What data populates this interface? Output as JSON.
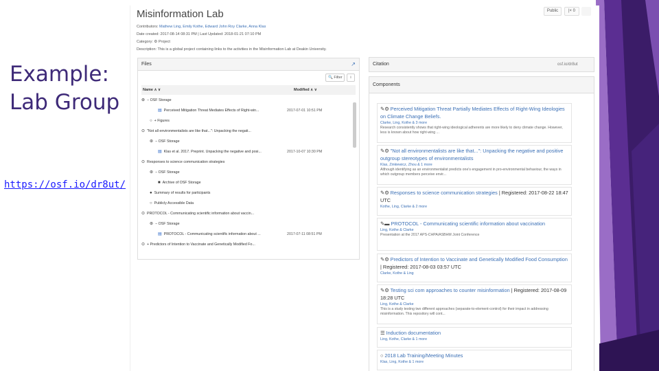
{
  "slide": {
    "title_line1": "Example:",
    "title_line2": "Lab Group",
    "link": "https://osf.io/dr8ut/"
  },
  "project": {
    "title": "Misinformation Lab",
    "public_label": "Public",
    "fork_label": "|× 0",
    "contributors_label": "Contributors:",
    "contributors": "Mathew Ling, Emily Kothe, Edward John Roy Clarke, Anna Klas",
    "date_created": "Date created: 2017-08-14 08:31 PM | Last Updated: 2018-01-21 07:10 PM",
    "category": "Category: ⚙ Project",
    "description": "Description: This is a global project containing links to the activities in the Misinformation Lab at Deakin University."
  },
  "files": {
    "header": "Files",
    "filter_label": "🔍 Filter",
    "col_name": "Name ∧ ∨",
    "col_modified": "Modified ∧ ∨",
    "rows": [
      {
        "name": "− OSF Storage",
        "icon": "⊛",
        "modified": ""
      },
      {
        "name": "Perceived Mitigation Threat Mediates Effects of Right-win...",
        "icon": "▤",
        "modified": "2017-07-01 10:51 PM"
      },
      {
        "name": "+ Figures",
        "icon": "○",
        "modified": ""
      },
      {
        "name": "\"Not all environmentalists are like that...\": Unpacking the negati...",
        "icon": "⊙",
        "modified": ""
      },
      {
        "name": "− OSF Storage",
        "icon": "⊛",
        "modified": ""
      },
      {
        "name": "Klas et al. 2017. Preprint. Unpacking the negative and posi...",
        "icon": "▤",
        "modified": "2017-10-07 10:30 PM"
      },
      {
        "name": "Responses to science communication strategies",
        "icon": "⊙",
        "modified": ""
      },
      {
        "name": "− OSF Storage",
        "icon": "⊛",
        "modified": ""
      },
      {
        "name": "Archive of OSF Storage",
        "icon": "■",
        "modified": ""
      },
      {
        "name": "Summary of results for participants",
        "icon": "●",
        "modified": ""
      },
      {
        "name": "Publicly Accessible Data",
        "icon": "○",
        "modified": ""
      },
      {
        "name": "PROTOCOL - Communicating scientific information about vaccin...",
        "icon": "⊙",
        "modified": ""
      },
      {
        "name": "− OSF Storage",
        "icon": "⊛",
        "modified": ""
      },
      {
        "name": "PROTOCOL - Communicating scientific information about ...",
        "icon": "▤",
        "modified": "2017-07-11 08:51 PM"
      },
      {
        "name": "+ Predictors of Intention to Vaccinate and Genetically Modified Fo...",
        "icon": "⊙",
        "modified": ""
      }
    ]
  },
  "citation": {
    "header": "Citation",
    "value": "osf.io/dr8ut"
  },
  "components": {
    "header": "Components",
    "items": [
      {
        "icon": "✎⚙",
        "title": "Perceived Mitigation Threat Partially Mediates Effects of Right-Wing Ideologies on Climate Change Beliefs.",
        "reg": "",
        "contrib": "Clarke, Ling, Kothe & 3 more",
        "desc": "Research consistently shows that right-wing ideological adherents are more likely to deny climate change. However, less is known about how right-wing ..."
      },
      {
        "icon": "✎⚙",
        "title": "\"Not all environmentalists are like that...\": Unpacking the negative and positive outgroup stereotypes of environmentalists",
        "reg": "",
        "contrib": "Klas, Zinkiewicz, Zhou & 1 more",
        "desc": "Although identifying as an environmentalist predicts one's engagement in pro-environmental behaviour, the ways in which outgroup members perceive envir..."
      },
      {
        "icon": "✎⚙",
        "title": "Responses to science communication strategies",
        "reg": " | Registered: 2017-08-22 18:47 UTC",
        "contrib": "Kothe, Ling, Clarke & 2 more",
        "desc": ""
      },
      {
        "icon": "✎▬",
        "title": "PROTOCOL - Communicating scientific information about vaccination",
        "reg": "",
        "contrib": "Ling, Kothe & Clarke",
        "desc": "Presentation at the 2017 APS-CHPA/ASBHM Joint Conference"
      },
      {
        "icon": "✎⚙",
        "title": "Predictors of Intention to Vaccinate and Genetically Modified Food Consumption",
        "reg": " | Registered: 2017-08-03 03:57 UTC",
        "contrib": "Clarke, Kothe & Ling",
        "desc": ""
      },
      {
        "icon": "✎⚙",
        "title": "Testing sci com approaches to counter misinformation",
        "reg": " | Registered: 2017-08-09 18:28 UTC",
        "contrib": "Ling, Kothe & Clarke",
        "desc": "This is a study testing two different approaches (separate-to-element-control) for their impact in addressing misinformation. This repository will cont..."
      },
      {
        "icon": "☰",
        "title": "Induction documentation",
        "reg": "",
        "contrib": "Ling, Kothe, Clarke & 1 more",
        "desc": ""
      },
      {
        "icon": "○",
        "title": "2018 Lab Training/Meeting Minutes",
        "reg": "",
        "contrib": "Klas, Ling, Kothe & 1 more",
        "desc": ""
      }
    ]
  },
  "colors": {
    "purple_dark": "#3b1c68",
    "purple_mid": "#6a3aa0",
    "purple_light": "#9a6dc6",
    "title": "#3e2a78",
    "link": "#1a1aff",
    "osf_link": "#3a6fb5"
  }
}
